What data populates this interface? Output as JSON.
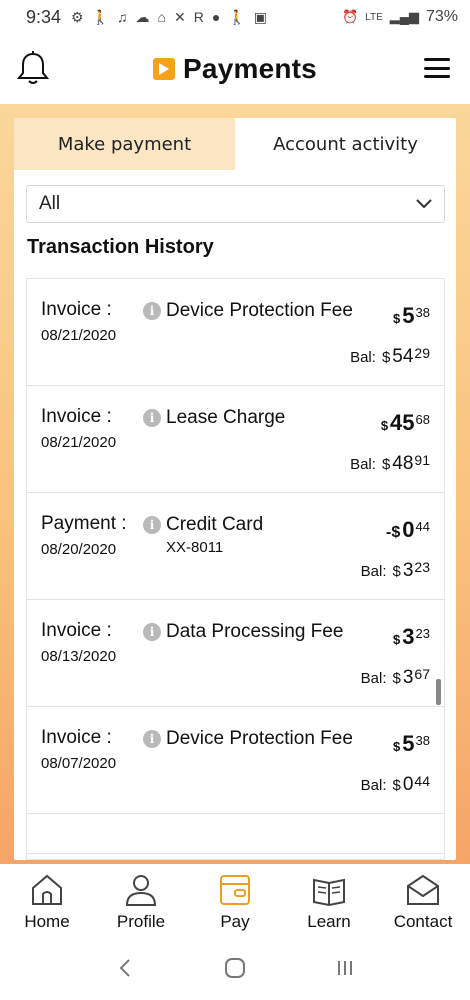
{
  "status_bar": {
    "time": "9:34",
    "battery": "73%",
    "network": "LTE",
    "left_icons": [
      "settings-icon",
      "walk-icon",
      "music-icon",
      "home-icon",
      "home-icon",
      "running-icon",
      "r-icon",
      "c-icon",
      "walk-icon",
      "image-icon"
    ],
    "right_icons": [
      "alarm-icon",
      "lte-icon",
      "signal-icon",
      "battery-icon"
    ]
  },
  "header": {
    "title": "Payments",
    "brand_color": "#f7a21b"
  },
  "tabs": [
    {
      "label": "Make payment",
      "active": false
    },
    {
      "label": "Account activity",
      "active": true
    }
  ],
  "filter": {
    "selected": "All"
  },
  "section_title": "Transaction History",
  "transactions": [
    {
      "type": "Invoice :",
      "date": "08/21/2020",
      "desc": "Device Protection Fee",
      "sub": "",
      "amount_prefix": "$",
      "amount_whole": "5",
      "amount_cents": "38",
      "bal_label": "Bal:",
      "bal_prefix": "$",
      "bal_whole": "54",
      "bal_cents": "29"
    },
    {
      "type": "Invoice :",
      "date": "08/21/2020",
      "desc": "Lease Charge",
      "sub": "",
      "amount_prefix": "$",
      "amount_whole": "45",
      "amount_cents": "68",
      "bal_label": "Bal:",
      "bal_prefix": "$",
      "bal_whole": "48",
      "bal_cents": "91"
    },
    {
      "type": "Payment :",
      "date": "08/20/2020",
      "desc": "Credit Card",
      "sub": "XX-8011",
      "amount_prefix": "-$",
      "amount_whole": "0",
      "amount_cents": "44",
      "bal_label": "Bal:",
      "bal_prefix": "$",
      "bal_whole": "3",
      "bal_cents": "23"
    },
    {
      "type": "Invoice :",
      "date": "08/13/2020",
      "desc": "Data Processing Fee",
      "sub": "",
      "amount_prefix": "$",
      "amount_whole": "3",
      "amount_cents": "23",
      "bal_label": "Bal:",
      "bal_prefix": "$",
      "bal_whole": "3",
      "bal_cents": "67"
    },
    {
      "type": "Invoice :",
      "date": "08/07/2020",
      "desc": "Device Protection Fee",
      "sub": "",
      "amount_prefix": "$",
      "amount_whole": "5",
      "amount_cents": "38",
      "bal_label": "Bal:",
      "bal_prefix": "$",
      "bal_whole": "0",
      "bal_cents": "44"
    }
  ],
  "bottom_nav": [
    {
      "label": "Home",
      "icon": "home-icon"
    },
    {
      "label": "Profile",
      "icon": "profile-icon"
    },
    {
      "label": "Pay",
      "icon": "wallet-icon",
      "active": true
    },
    {
      "label": "Learn",
      "icon": "book-icon"
    },
    {
      "label": "Contact",
      "icon": "mail-icon"
    }
  ],
  "colors": {
    "accent": "#f7a21b",
    "tab_inactive_bg": "#fbe6c4",
    "gradient_top": "#fbd79b",
    "gradient_bottom": "#f6a567"
  }
}
